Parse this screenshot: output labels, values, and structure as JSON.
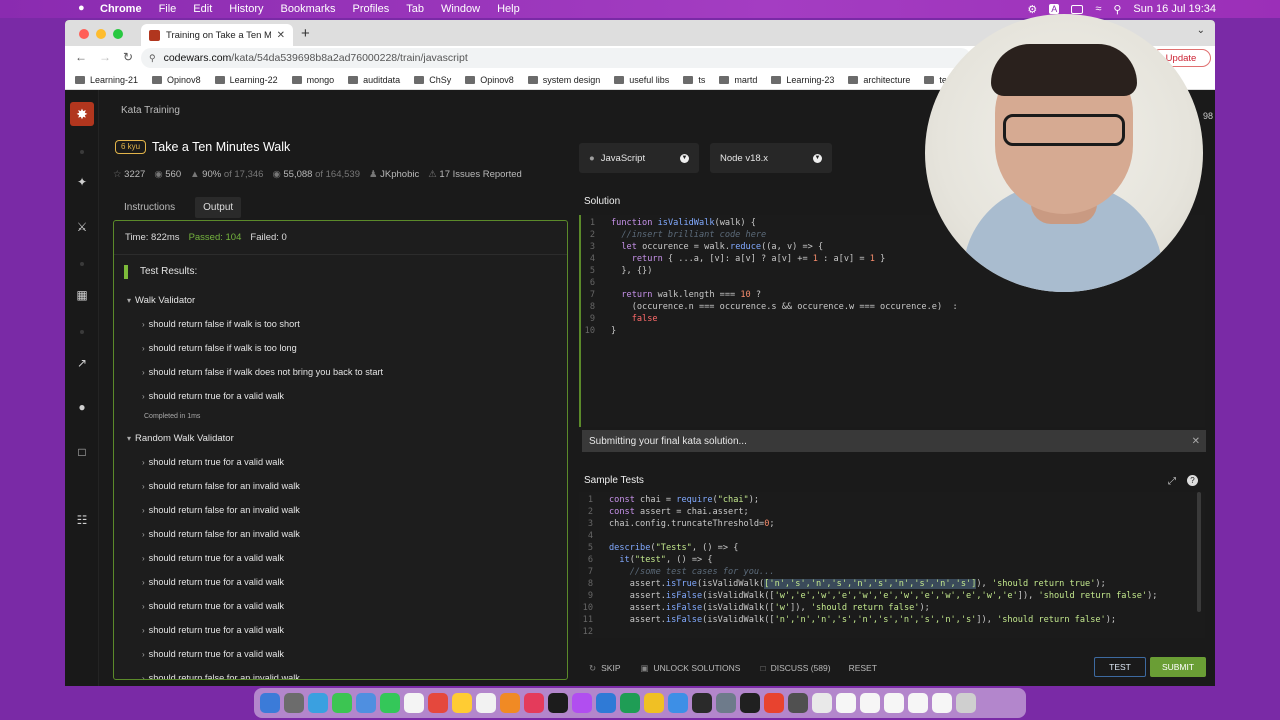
{
  "menubar": {
    "app": "Chrome",
    "menus": [
      "File",
      "Edit",
      "History",
      "Bookmarks",
      "Profiles",
      "Tab",
      "Window",
      "Help"
    ],
    "clock": "Sun 16 Jul  19:34",
    "input_letter": "A"
  },
  "browser": {
    "tab_title": "Training on Take a Ten Minutes",
    "url_host": "codewars.com",
    "url_path": "/kata/54da539698b8a2ad76000228/train/javascript",
    "update_label": "Update",
    "bookmarks": [
      "Learning-21",
      "Opinov8",
      "Learning-22",
      "mongo",
      "auditdata",
      "ChSy",
      "Opinov8",
      "system design",
      "useful libs",
      "ts",
      "martd",
      "Learning-23",
      "architecture",
      "technicu"
    ]
  },
  "kata": {
    "section": "Kata Training",
    "rank": "6 kyu",
    "title": "Take a Ten Minutes Walk",
    "stars": "3227",
    "votes": "560",
    "satisfaction": "90%",
    "satisfaction_of": "of 17,346",
    "completions": "55,088",
    "completions_of": "of 164,539",
    "author": "JKphobic",
    "issues": "17 Issues Reported",
    "corner_number": "98"
  },
  "left_tabs": {
    "instructions": "Instructions",
    "output": "Output"
  },
  "output": {
    "time": "Time: 822ms",
    "passed": "Passed: 104",
    "failed": "Failed: 0",
    "results_title": "Test Results:",
    "group1": "Walk Validator",
    "group1_items": [
      "should return false if walk is too short",
      "should return false if walk is too long",
      "should return false if walk does not bring you back to start",
      "should return true for a valid walk"
    ],
    "completed": "Completed in 1ms",
    "group2": "Random Walk Validator",
    "group2_items": [
      "should return true for a valid walk",
      "should return false for an invalid walk",
      "should return false for an invalid walk",
      "should return false for an invalid walk",
      "should return true for a valid walk",
      "should return true for a valid walk",
      "should return true for a valid walk",
      "should return true for a valid walk",
      "should return true for a valid walk",
      "should return false for an invalid walk"
    ]
  },
  "selectors": {
    "language": "JavaScript",
    "runtime": "Node v18.x"
  },
  "solution": {
    "title": "Solution"
  },
  "notice": {
    "text": "Submitting your final kata solution..."
  },
  "sample_tests": {
    "title": "Sample Tests"
  },
  "footer": {
    "skip": "SKIP",
    "unlock": "UNLOCK SOLUTIONS",
    "discuss": "DISCUSS (589)",
    "reset": "RESET",
    "test": "TEST",
    "submit": "SUBMIT"
  },
  "colors": {
    "accent": "#b1361e",
    "pass": "#74b33e",
    "submit": "#6a9e35",
    "kyu": "#e2b44a"
  },
  "icons": [
    "apple-icon",
    "search-icon",
    "wifi-icon",
    "battery-icon",
    "codewars-logo-icon",
    "star-icon",
    "bullseye-icon",
    "thumbs-up-icon",
    "warning-icon",
    "user-icon",
    "chevron-down-icon",
    "close-icon",
    "expand-icon",
    "help-icon"
  ]
}
